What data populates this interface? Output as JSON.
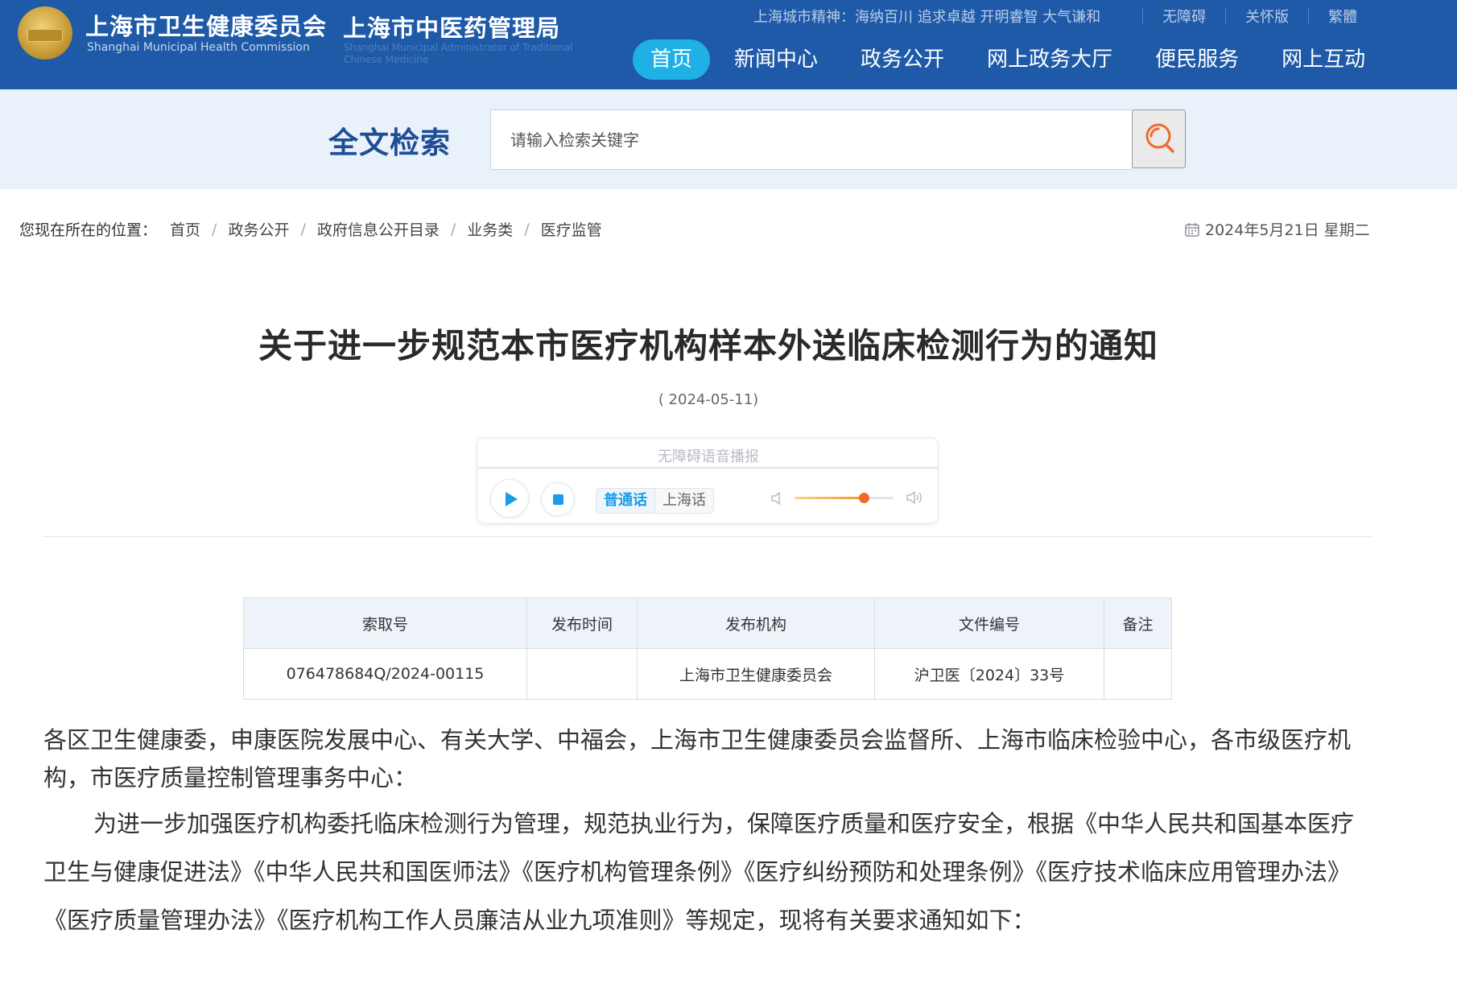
{
  "header": {
    "org_name": "上海市卫生健康委员会",
    "org_name_en": "Shanghai Municipal Health Commission",
    "org2_name": "上海市中医药管理局",
    "org2_name_en": "Shanghai Municipal Administrator of Traditional Chinese Medicine",
    "city_spirit": "上海城市精神：海纳百川 追求卓越 开明睿智 大气谦和",
    "top_links": [
      "无障碍",
      "关怀版",
      "繁體"
    ],
    "nav": [
      "首页",
      "新闻中心",
      "政务公开",
      "网上政务大厅",
      "便民服务",
      "网上互动"
    ],
    "active_nav": "首页"
  },
  "search": {
    "title": "全文检索",
    "placeholder": "请输入检索关键字"
  },
  "breadcrumb": {
    "prefix": "您现在所在的位置：",
    "items": [
      "首页",
      "政务公开",
      "政府信息公开目录",
      "业务类",
      "医疗监管"
    ]
  },
  "current_date": "2024年5月21日 星期二",
  "article": {
    "title": "关于进一步规范本市医疗机构样本外送临床检测行为的通知",
    "date": "( 2024-05-11)",
    "player": {
      "label": "无障碍语音播报",
      "languages": [
        "普通话",
        "上海话"
      ],
      "active_language": "普通话",
      "volume": 0.7
    },
    "info_table": {
      "headers": [
        "索取号",
        "发布时间",
        "发布机构",
        "文件编号",
        "备注"
      ],
      "row": [
        "076478684Q/2024-00115",
        "",
        "上海市卫生健康委员会",
        "沪卫医〔2024〕33号",
        ""
      ]
    },
    "paragraphs": [
      "各区卫生健康委，申康医院发展中心、有关大学、中福会，上海市卫生健康委员会监督所、上海市临床检验中心，各市级医疗机构，市医疗质量控制管理事务中心：",
      "为进一步加强医疗机构委托临床检测行为管理，规范执业行为，保障医疗质量和医疗安全，根据《中华人民共和国基本医疗卫生与健康促进法》《中华人民共和国医师法》《医疗机构管理条例》《医疗纠纷预防和处理条例》《医疗技术临床应用管理办法》《医疗质量管理办法》《医疗机构工作人员廉洁从业九项准则》等规定，现将有关要求通知如下："
    ]
  },
  "colors": {
    "header_bg": "#1e5aa8",
    "nav_active": "#1fb1e6",
    "search_band": "#e9f1fa",
    "search_title": "#1e4e96",
    "search_icon": "#f06a2b",
    "player_accent": "#1c9be6"
  }
}
